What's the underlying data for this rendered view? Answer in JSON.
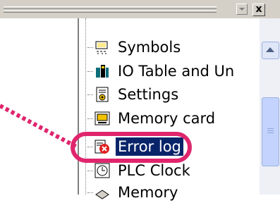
{
  "toolbar": {
    "dropdown": "▾",
    "close": "x"
  },
  "tree": {
    "items": [
      {
        "label": "Symbols",
        "icon": "symbols-icon"
      },
      {
        "label": "IO Table and Un",
        "icon": "io-table-icon"
      },
      {
        "label": "Settings",
        "icon": "settings-icon"
      },
      {
        "label": "Memory card",
        "icon": "memory-card-icon"
      },
      {
        "label": "Error log",
        "icon": "error-log-icon",
        "selected": true
      },
      {
        "label": "PLC Clock",
        "icon": "plc-clock-icon"
      },
      {
        "label": "Memory",
        "icon": "memory-icon"
      }
    ]
  },
  "colors": {
    "selection": "#0a246a",
    "highlight": "#e0256d"
  }
}
